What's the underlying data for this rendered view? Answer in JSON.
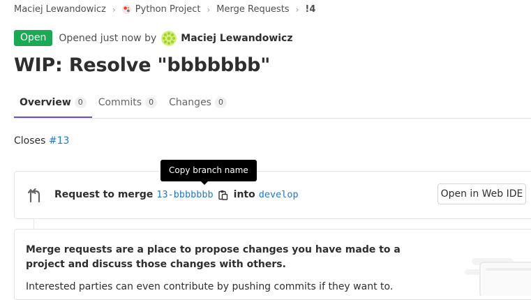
{
  "breadcrumb": {
    "user": "Maciej Lewandowicz",
    "project": "Python Project",
    "section": "Merge Requests",
    "current": "!4"
  },
  "header": {
    "status": "Open",
    "opened_text": "Opened just now by",
    "author": "Maciej Lewandowicz",
    "title": "WIP: Resolve \"bbbbbbb\""
  },
  "tabs": [
    {
      "label": "Overview",
      "count": "0"
    },
    {
      "label": "Commits",
      "count": "0"
    },
    {
      "label": "Changes",
      "count": "0"
    }
  ],
  "description": {
    "closes_label": "Closes",
    "closes_issue": "#13"
  },
  "merge_widget": {
    "request_label": "Request to merge",
    "source_branch": "13-bbbbbbb",
    "into_label": "into",
    "target_branch": "develop",
    "ide_button": "Open in Web IDE",
    "tooltip": "Copy branch name"
  },
  "empty_state": {
    "heading": "Merge requests are a place to propose changes you have made to a project and discuss those changes with others.",
    "body": "Interested parties can even contribute by pushing commits if they want to."
  },
  "colors": {
    "accent": "#6b4fbb",
    "status_open": "#1aaa55",
    "link": "#1f78d1"
  }
}
